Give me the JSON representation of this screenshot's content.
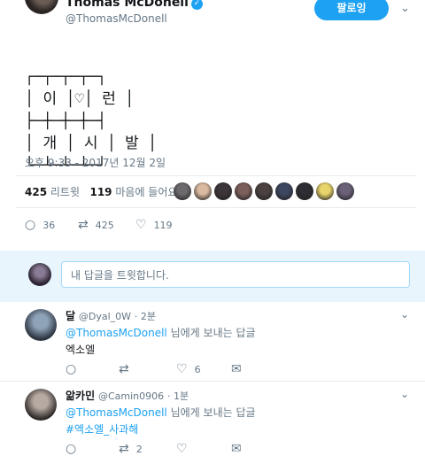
{
  "tweet": {
    "author_name": "Thomas McDonell",
    "author_handle": "@ThomasMcDonell",
    "follow_label": "팔로잉",
    "verified_glyph": "✓",
    "more_glyph": "⌄",
    "body_lines": [
      "┌─┬─┬─┬─┐",
      "│ 이 │♡│ 런 │",
      "├─┼─┼─┼─┤",
      "│ 개 │ 시 │ 발 │",
      "└─┴─┴─┴─┘"
    ],
    "timestamp": "오후 9:33 - 2017년 12월 2일",
    "retweets_count": "425",
    "retweets_label": "리트윗",
    "likes_count": "119",
    "likes_label": "마음에 들어요",
    "liker_colors": [
      "#6d6a6e",
      "#d9b9a0",
      "#3c3539",
      "#7b5f5a",
      "#4a4140",
      "#3d4660",
      "#2e2d33",
      "#e8d46a",
      "#6a6178"
    ],
    "actions": {
      "reply_count": "36",
      "retweet_count": "425",
      "like_count": "119"
    }
  },
  "compose": {
    "placeholder": "내 답글을 트윗합니다."
  },
  "replies": [
    {
      "name": "달",
      "handle": "@Dyal_0W",
      "time": "· 2분",
      "replying_to": "@ThomasMcDonell",
      "replying_suffix": "님에게 보내는 답글",
      "text": "엑소엘",
      "hashtag": false,
      "reply_count": "",
      "retweet_count": "",
      "like_count": "6"
    },
    {
      "name": "앎카민",
      "handle": "@Camin0906",
      "time": "· 1분",
      "replying_to": "@ThomasMcDonell",
      "replying_suffix": "님에게 보내는 답글",
      "text": "#엑소엘_사과해",
      "hashtag": true,
      "reply_count": "",
      "retweet_count": "2",
      "like_count": ""
    }
  ],
  "icons": {
    "reply": "○",
    "retweet": "⇄",
    "like": "♡",
    "dm": "✉",
    "caret": "⌄"
  },
  "colors": {
    "accent": "#1da1f2",
    "compose_bg": "#e8f5fd",
    "muted": "#657786"
  }
}
